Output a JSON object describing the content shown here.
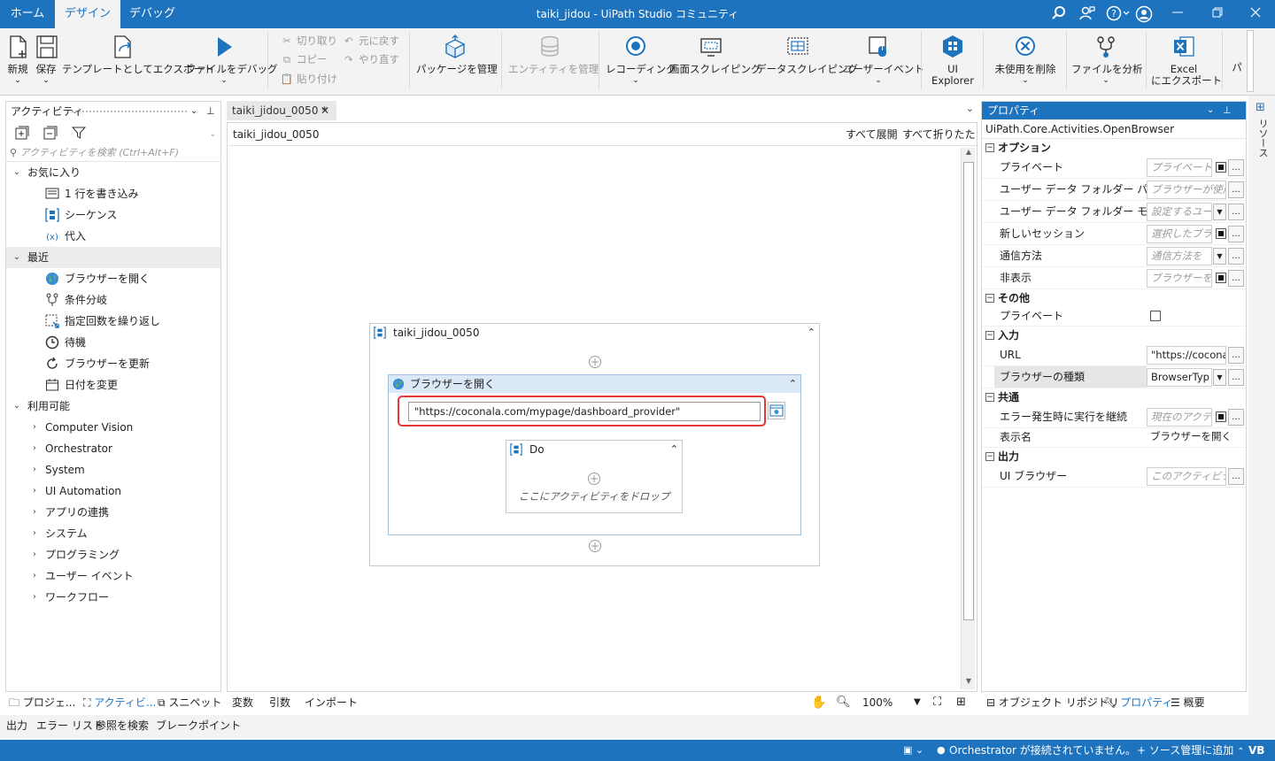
{
  "menu": {
    "tabs": [
      {
        "label": "ホーム"
      },
      {
        "label": "デザイン"
      },
      {
        "label": "デバッグ"
      }
    ],
    "title": "taiki_jidou - UiPath Studio コミュニティ"
  },
  "ribbon": {
    "new_label": "新規",
    "save_label": "保存",
    "export_template_label": "テンプレートとしてエクスポート",
    "debug_file_label": "ファイルをデバッグ",
    "cut_label": "切り取り",
    "copy_label": "コピー",
    "paste_label": "貼り付け",
    "undo_label": "元に戻す",
    "redo_label": "やり直す",
    "manage_packages_label": "パッケージを管理",
    "manage_entities_label": "エンティティを管理",
    "recording_label": "レコーディング",
    "screen_scraping_label": "画面スクレイピング",
    "data_scraping_label": "データスクレイピング",
    "user_events_label": "ユーザーイベント",
    "ui_explorer_label_1": "UI",
    "ui_explorer_label_2": "Explorer",
    "remove_unused_label": "未使用を削除",
    "analyze_file_label": "ファイルを分析",
    "excel_export_label_1": "Excel",
    "excel_export_label_2": "にエクスポート",
    "more_label": "パ"
  },
  "activities_panel": {
    "title": "アクティビティ",
    "search_placeholder": "アクティビティを検索 (Ctrl+Alt+F)",
    "favorites": {
      "label": "お気に入り",
      "items": [
        {
          "label": "1 行を書き込み"
        },
        {
          "label": "シーケンス"
        },
        {
          "label": "代入"
        }
      ]
    },
    "recent": {
      "label": "最近",
      "items": [
        {
          "label": "ブラウザーを開く"
        },
        {
          "label": "条件分岐"
        },
        {
          "label": "指定回数を繰り返し"
        },
        {
          "label": "待機"
        },
        {
          "label": "ブラウザーを更新"
        },
        {
          "label": "日付を変更"
        }
      ]
    },
    "available": {
      "label": "利用可能",
      "items": [
        {
          "label": "Computer Vision"
        },
        {
          "label": "Orchestrator"
        },
        {
          "label": "System"
        },
        {
          "label": "UI Automation"
        },
        {
          "label": "アプリの連携"
        },
        {
          "label": "システム"
        },
        {
          "label": "プログラミング"
        },
        {
          "label": "ユーザー イベント"
        },
        {
          "label": "ワークフロー"
        }
      ]
    },
    "bottom_tabs": [
      {
        "label": "プロジェ..."
      },
      {
        "label": "アクティビ..."
      },
      {
        "label": "スニペット"
      }
    ]
  },
  "designer": {
    "tab_label": "taiki_jidou_0050 *",
    "breadcrumb": "taiki_jidou_0050",
    "expand_all": "すべて展開",
    "collapse_all": "すべて折りたたみ",
    "sequence_title": "taiki_jidou_0050",
    "open_browser_title": "ブラウザーを開く",
    "url_value": "\"https://coconala.com/mypage/dashboard_provider\"",
    "do_title": "Do",
    "drop_hint": "ここにアクティビティをドロップ",
    "footer": {
      "variables": "変数",
      "arguments": "引数",
      "imports": "インポート",
      "zoom": "100%"
    }
  },
  "properties": {
    "title": "プロパティ",
    "type_name": "UiPath.Core.Activities.OpenBrowser",
    "categories": {
      "options": "オプション",
      "misc": "その他",
      "input": "入力",
      "common": "共通",
      "output": "出力"
    },
    "options_rows": [
      {
        "name": "プライベート",
        "value": "プライベート/...",
        "placeholder": true
      },
      {
        "name": "ユーザー データ フォルダー パス",
        "value": "ブラウザーが使用",
        "placeholder": true
      },
      {
        "name": "ユーザー データ フォルダー モード",
        "value": "設定するユー",
        "placeholder": true
      },
      {
        "name": "新しいセッション",
        "value": "選択したブラ",
        "placeholder": true
      },
      {
        "name": "通信方法",
        "value": "通信方法を",
        "placeholder": true
      },
      {
        "name": "非表示",
        "value": "ブラウザーを",
        "placeholder": true
      }
    ],
    "misc_rows": [
      {
        "name": "プライベート"
      }
    ],
    "input_rows": [
      {
        "name": "URL",
        "value": "\"https://cocona"
      },
      {
        "name": "ブラウザーの種類",
        "value": "BrowserTyp"
      }
    ],
    "common_rows": [
      {
        "name": "エラー発生時に実行を継続",
        "value": "現在のアクテ",
        "placeholder": true
      },
      {
        "name": "表示名",
        "value": "ブラウザーを開く"
      }
    ],
    "output_rows": [
      {
        "name": "UI ブラウザー",
        "value": "このアクティビテ",
        "placeholder": true
      }
    ],
    "bottom_tabs": [
      {
        "label": "オブジェクト リポジトリ"
      },
      {
        "label": "プロパティ"
      },
      {
        "label": "概要"
      }
    ],
    "side_strip_label": "リソース"
  },
  "output_strip": {
    "tabs": [
      {
        "label": "出力"
      },
      {
        "label": "エラー リスト"
      },
      {
        "label": "参照を検索"
      },
      {
        "label": "ブレークポイント"
      }
    ]
  },
  "status": {
    "orchestrator": "Orchestrator が接続されていません。",
    "source_control": "ソース管理に追加",
    "language": "VB"
  },
  "colors": {
    "accent": "#1e73be",
    "highlight_border": "#e53935"
  }
}
